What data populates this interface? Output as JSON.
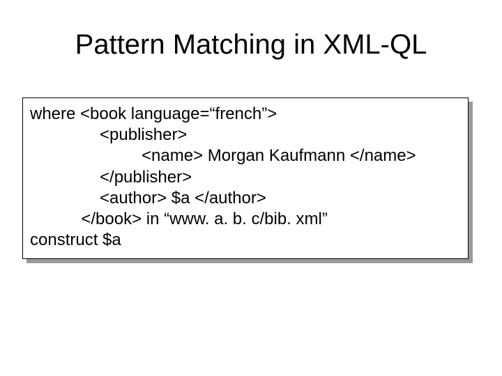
{
  "slide": {
    "title": "Pattern Matching in XML-QL",
    "code": {
      "line1": "where <book language=“french”>",
      "line2": "               <publisher>",
      "line3": "                        <name> Morgan Kaufmann </name>",
      "line4": "               </publisher>",
      "line5": "               <author> $a </author>",
      "line6": "           </book> in “www. a. b. c/bib. xml”",
      "line7": "construct $a"
    }
  }
}
